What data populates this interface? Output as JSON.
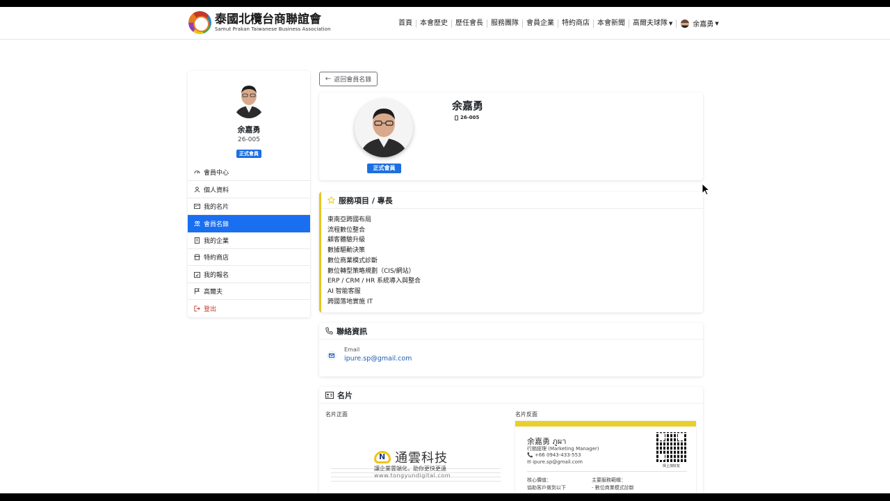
{
  "navbar": {
    "brand_title": "泰國北欖台商聯誼會",
    "brand_subtitle": "Samut Prakan Taiwanese Business Association",
    "items": [
      "首頁",
      "本會歷史",
      "歷任會長",
      "服務團隊",
      "會員企業",
      "特約商店",
      "本會新聞",
      "高爾夫球隊"
    ],
    "user_name": "余嘉勇"
  },
  "sidebar": {
    "name": "余嘉勇",
    "member_id": "26-005",
    "badge": "正式會員",
    "menu": [
      "會員中心",
      "個人資料",
      "我的名片",
      "會員名錄",
      "我的企業",
      "特約商店",
      "我的報名",
      "高爾夫",
      "登出"
    ],
    "active_index": 3
  },
  "back_button": "返回會員名錄",
  "profile": {
    "name": "余嘉勇",
    "member_id": "26-005",
    "badge": "正式會員"
  },
  "services": {
    "title": "服務項目 / 專長",
    "items": [
      "東南亞跨國布局",
      "流程數位整合",
      "顧客體驗升級",
      "數據驅動決策",
      "數位商業模式診斷",
      "數位轉型策略規劃（CIS/網站）",
      "ERP / CRM / HR 系統導入與整合",
      "AI 智能客服",
      "跨國落地實施 IT"
    ]
  },
  "contact": {
    "title": "聯絡資訊",
    "email_label": "Email",
    "email_value": "ipure.sp@gmail.com"
  },
  "business_cards": {
    "title": "名片",
    "front_label": "名片正面",
    "back_label": "名片反面",
    "front_company": "通雲科技",
    "front_tagline": "讓企業雲端化，助你更快更遠",
    "front_url": "www.tongyundigital.com",
    "back_name": "余嘉勇 ภูผา",
    "back_title": "行銷經理 (Marketing Manager)",
    "back_phone": "+66 0943-433-553",
    "back_email": "ipure.sp@gmail.com",
    "back_qr_caption": "掃上加好友",
    "back_core_label": "核心價值：",
    "back_core_text": "協助客戶做到以下",
    "back_scope_label": "主要服務範疇：",
    "back_scope_text": "- 數位商業模式診斷"
  },
  "colors": {
    "primary": "#1a6ef0",
    "accent_yellow": "#e6c619",
    "logout_red": "#c0392b",
    "link": "#1a5fb4"
  }
}
